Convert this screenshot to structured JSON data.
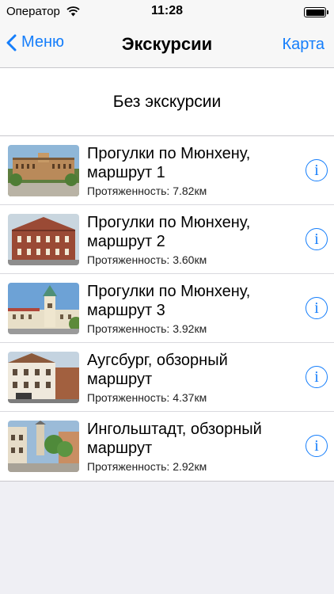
{
  "status": {
    "carrier": "Оператор",
    "time": "11:28"
  },
  "nav": {
    "back_label": "Меню",
    "title": "Экскурсии",
    "right_label": "Карта"
  },
  "no_tour_label": "Без экскурсии",
  "tours": [
    {
      "title": "Прогулки по Мюнхену, маршрут 1",
      "length": "Протяженность: 7.82км",
      "thumb_icon": "munich-palace-photo"
    },
    {
      "title": "Прогулки по Мюнхену, маршрут 2",
      "length": "Протяженность: 3.60км",
      "thumb_icon": "red-brick-building-photo"
    },
    {
      "title": "Прогулки по Мюнхену, маршрут 3",
      "length": "Протяженность: 3.92км",
      "thumb_icon": "tower-building-photo"
    },
    {
      "title": "Аугсбург, обзорный маршрут",
      "length": "Протяженность: 4.37км",
      "thumb_icon": "augsburg-street-photo"
    },
    {
      "title": "Ингольштадт, обзорный маршрут",
      "length": "Протяженность: 2.92км",
      "thumb_icon": "ingolstadt-street-photo"
    }
  ],
  "info_icon_glyph": "i",
  "colors": {
    "accent": "#157efb",
    "background": "#efeff4"
  }
}
